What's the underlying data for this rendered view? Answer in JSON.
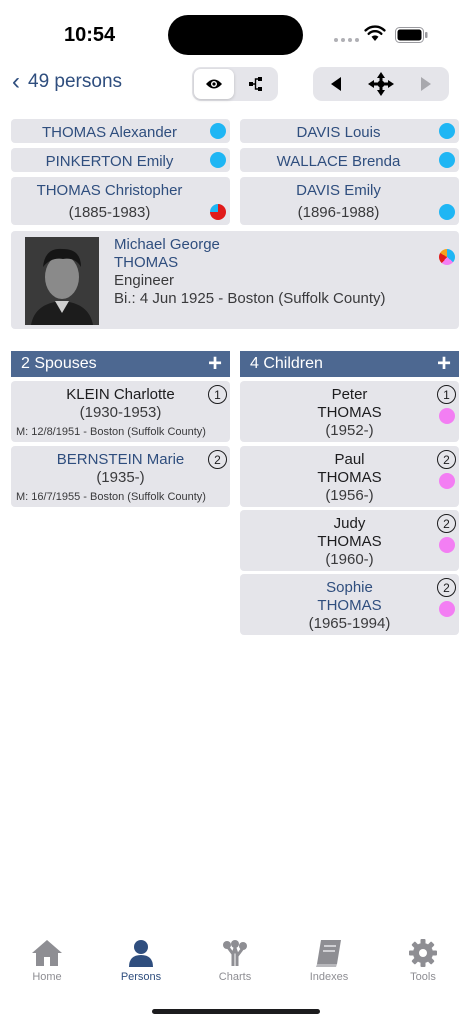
{
  "status": {
    "time": "10:54"
  },
  "nav": {
    "back_label": "49 persons",
    "segments": [
      "eye-icon",
      "tree-icon"
    ],
    "nav_buttons": [
      "previous-arrow-icon",
      "center-icon",
      "next-arrow-icon"
    ]
  },
  "ancestors": [
    {
      "name": "THOMAS Alexander",
      "dates": "",
      "marker": "blue"
    },
    {
      "name": "DAVIS Louis",
      "dates": "",
      "marker": "blue"
    },
    {
      "name": "PINKERTON Emily",
      "dates": "",
      "marker": "blue"
    },
    {
      "name": "WALLACE Brenda",
      "dates": "",
      "marker": "blue"
    },
    {
      "name": "THOMAS Christopher",
      "dates": "(1885-1983)",
      "marker": "pie-red"
    },
    {
      "name": "DAVIS Emily",
      "dates": "(1896-1988)",
      "marker": "blue"
    }
  ],
  "person": {
    "given_names": "Michael George",
    "surname": "THOMAS",
    "occupation": "Engineer",
    "birth": "Bi.: 4 Jun 1925 - Boston (Suffolk County)"
  },
  "spouses": {
    "header": "2 Spouses",
    "items": [
      {
        "name": "KLEIN Charlotte",
        "dates": "(1930-1953)",
        "marriage": "M: 12/8/1951 - Boston (Suffolk County)",
        "number": "1"
      },
      {
        "name": "BERNSTEIN Marie",
        "dates": "(1935-)",
        "marriage": "M: 16/7/1955 - Boston (Suffolk County)",
        "number": "2"
      }
    ]
  },
  "children": {
    "header": "4 Children",
    "items": [
      {
        "given": "Peter",
        "surname": "THOMAS",
        "dates": "(1952-)",
        "number": "1",
        "marker": "pink"
      },
      {
        "given": "Paul",
        "surname": "THOMAS",
        "dates": "(1956-)",
        "number": "2",
        "marker": "pink"
      },
      {
        "given": "Judy",
        "surname": "THOMAS",
        "dates": "(1960-)",
        "number": "2",
        "marker": "pink"
      },
      {
        "given": "Sophie",
        "surname": "THOMAS",
        "dates": "(1965-1994)",
        "number": "2",
        "marker": "pink"
      }
    ]
  },
  "tabs": [
    {
      "label": "Home",
      "icon": "home-icon"
    },
    {
      "label": "Persons",
      "icon": "person-icon",
      "active": true
    },
    {
      "label": "Charts",
      "icon": "chart-tree-icon"
    },
    {
      "label": "Indexes",
      "icon": "book-icon"
    },
    {
      "label": "Tools",
      "icon": "gear-icon"
    }
  ],
  "colors": {
    "link": "#2f4e7e",
    "header_bar": "#4d6891",
    "male_marker": "#1fb6f4",
    "female_marker": "#f37ef3",
    "card_bg": "#e5e5ea"
  }
}
